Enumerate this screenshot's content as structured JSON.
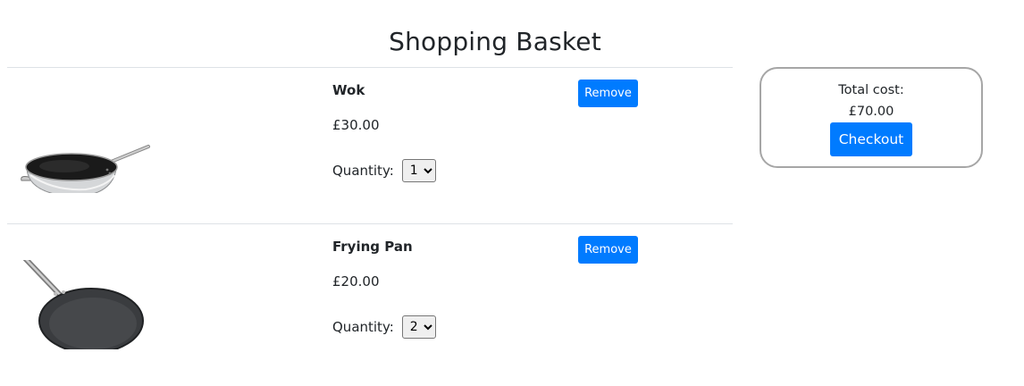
{
  "page": {
    "title": "Shopping Basket"
  },
  "basket": {
    "items": [
      {
        "name": "Wok",
        "price": "£30.00",
        "quantity_label": "Quantity:",
        "quantity": "1",
        "remove_label": "Remove",
        "image_icon": "wok-image"
      },
      {
        "name": "Frying Pan",
        "price": "£20.00",
        "quantity_label": "Quantity:",
        "quantity": "2",
        "remove_label": "Remove",
        "image_icon": "frying-pan-image"
      }
    ]
  },
  "summary": {
    "total_label": "Total cost:",
    "total_value": "£70.00",
    "checkout_label": "Checkout"
  },
  "colors": {
    "accent": "#007bff",
    "card_border": "#a6a6a6",
    "divider": "#dee2e6"
  }
}
